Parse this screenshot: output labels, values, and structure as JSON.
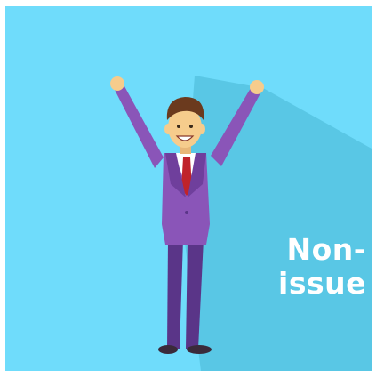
{
  "caption": {
    "line1": "Non-",
    "line2": "issue"
  },
  "colors": {
    "background": "#6fdcfb",
    "shadow": "#56c4e2",
    "suit": "#8a55b8",
    "suit_dark": "#6f3f9c",
    "skin": "#f6cc8c",
    "hair": "#6b3a1e",
    "tie": "#c0232a",
    "shirt": "#ffffff",
    "text": "#ffffff"
  },
  "illustration": {
    "subject": "businessman-celebrating",
    "icon": "cheering-man-icon"
  }
}
